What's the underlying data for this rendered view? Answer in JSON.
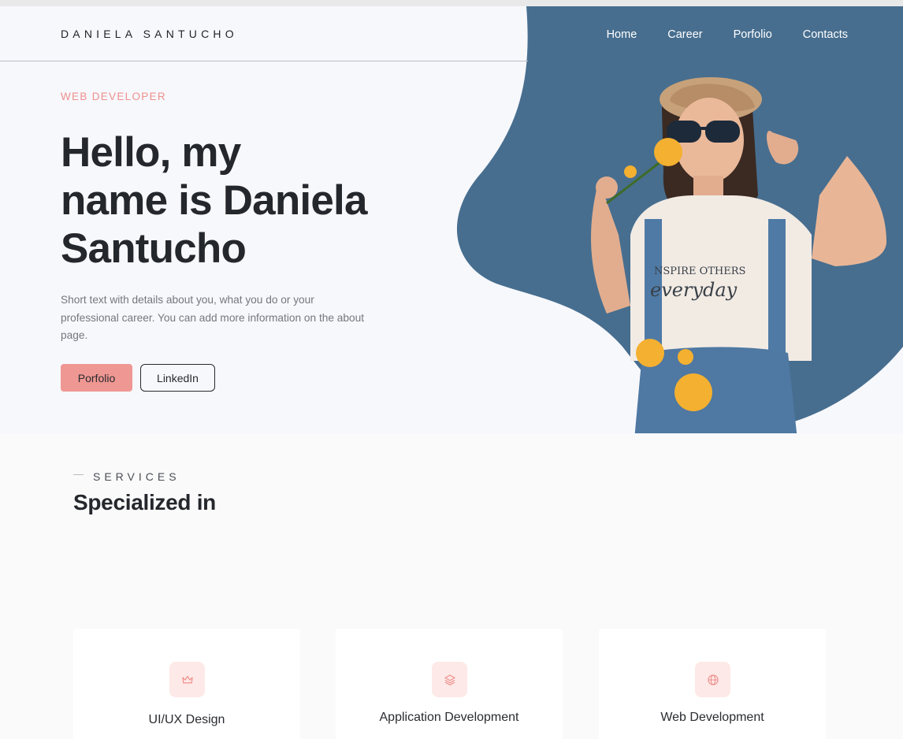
{
  "header": {
    "brand": "DANIELA SANTUCHO",
    "nav": [
      "Home",
      "Career",
      "Porfolio",
      "Contacts"
    ]
  },
  "hero": {
    "eyebrow": "WEB DEVELOPER",
    "headline_lines": [
      "Hello,  my",
      "name is Daniela",
      "Santucho"
    ],
    "description": "Short text with details about you, what you do or your professional career. You can add more information on the about page.",
    "primary_button": "Porfolio",
    "secondary_button": "LinkedIn",
    "photo_shirt_text": [
      "NSPIRE OTHERS",
      "everyday"
    ]
  },
  "services": {
    "eyebrow": "SERVICES",
    "title": "Specialized in",
    "cards": [
      {
        "label": "UI/UX Design",
        "icon": "crown-icon"
      },
      {
        "label": "Application Development",
        "icon": "layers-icon"
      },
      {
        "label": "Web Development",
        "icon": "globe-icon"
      }
    ]
  },
  "colors": {
    "accent": "#ef9793",
    "blob": "#476e8f",
    "text": "#24272b",
    "icon_bg": "#fde9e7"
  }
}
